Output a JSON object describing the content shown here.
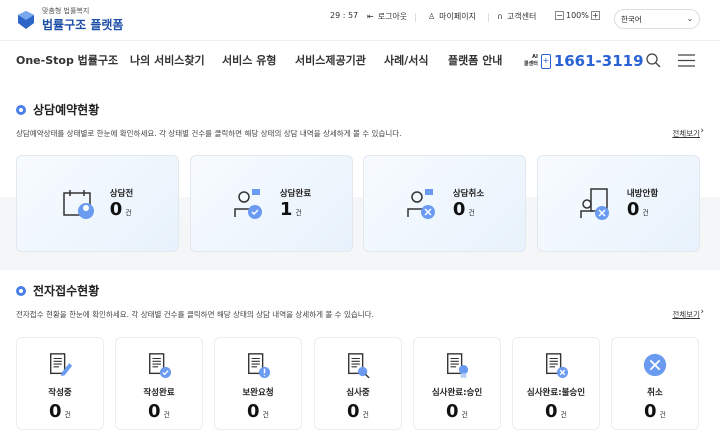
{
  "header": {
    "logo_sub": "맞춤형 법률복지",
    "logo_title": "법률구조 플랫폼",
    "timer": "29 : 57",
    "logout": "로그아웃",
    "mypage": "마이페이지",
    "support": "고객센터",
    "zoom_level": "100%",
    "language": "한국어"
  },
  "nav": {
    "items": [
      "One-Stop 법률구조",
      "나의 서비스찾기",
      "서비스 유형",
      "서비스제공기관",
      "사례/서식",
      "플랫폼 안내"
    ],
    "ai_label_1": "AI",
    "ai_label_2": "콜센터",
    "phone": "1661-3119"
  },
  "consult": {
    "title": "상담예약현황",
    "desc": "상담예약상태를 상태별로 한눈에 확인하세요. 각 상태별 건수를 클릭하면 해당 상태의 상담 내역을 상세하게 볼 수 있습니다.",
    "more": "전체보기",
    "unit": "건",
    "cards": [
      {
        "label": "상담전",
        "count": "0"
      },
      {
        "label": "상담완료",
        "count": "1"
      },
      {
        "label": "상담취소",
        "count": "0"
      },
      {
        "label": "내방안함",
        "count": "0"
      }
    ]
  },
  "ereceipt": {
    "title": "전자접수현황",
    "desc": "전자접수 현황을 한눈에 확인하세요. 각 상태별 건수를 클릭하면 해당 상태의 상담 내역을 상세하게 볼 수 있습니다.",
    "more": "전체보기",
    "unit": "건",
    "cards": [
      {
        "label": "작성중",
        "count": "0"
      },
      {
        "label": "작성완료",
        "count": "0"
      },
      {
        "label": "보완요청",
        "count": "0"
      },
      {
        "label": "심사중",
        "count": "0"
      },
      {
        "label": "심사완료:승인",
        "count": "0"
      },
      {
        "label": "심사완료:불승인",
        "count": "0"
      },
      {
        "label": "취소",
        "count": "0"
      }
    ]
  },
  "colors": {
    "accent": "#4a7ee8",
    "phone": "#2a62d6"
  }
}
